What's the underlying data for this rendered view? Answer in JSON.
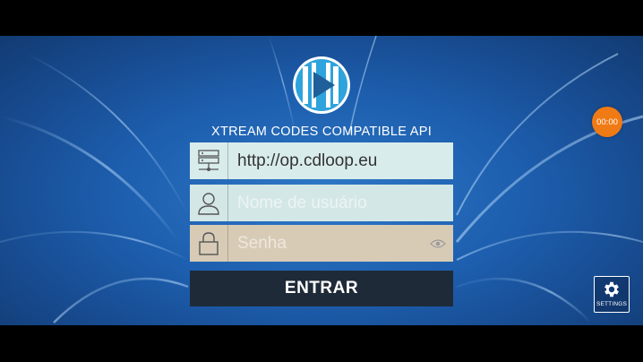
{
  "app": {
    "subtitle": "XTREAM CODES COMPATIBLE API"
  },
  "login": {
    "server_url_value": "http://op.cdloop.eu",
    "username_placeholder": "Nome de usuário",
    "password_placeholder": "Senha",
    "enter_button_label": "ENTRAR"
  },
  "overlay": {
    "timer_text": "00:00",
    "settings_label": "SETTINGS"
  },
  "icons": {
    "logo": "play-logo-icon",
    "server": "server-icon",
    "user": "user-icon",
    "lock": "lock-icon",
    "eye": "eye-icon",
    "settings": "gear-icon"
  },
  "colors": {
    "background": "#1d5eae",
    "timer": "#f07a14",
    "button": "#1f2a38",
    "logo_blue": "#2ea3dc"
  }
}
